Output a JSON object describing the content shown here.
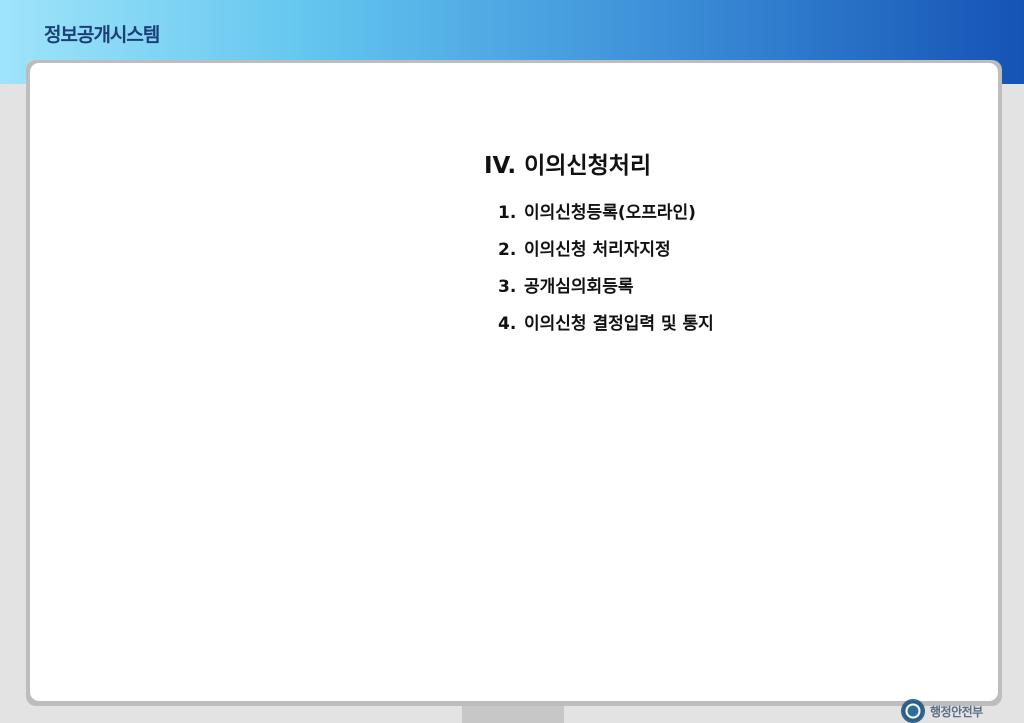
{
  "header": {
    "app_title": "정보공개시스템"
  },
  "content": {
    "section_title": "IV. 이의신청처리",
    "items": [
      {
        "number": "1.",
        "label": "이의신청등록(오프라인)"
      },
      {
        "number": "2.",
        "label": "이의신청 처리자지정"
      },
      {
        "number": "3.",
        "label": "공개심의회등록"
      },
      {
        "number": "4.",
        "label": "이의신청 결정입력 및 통지"
      }
    ]
  },
  "footer": {
    "ministry": "행정안전부",
    "emblem_icon": "government-emblem-icon"
  },
  "colors": {
    "header_gradient_start": "#9fe4fa",
    "header_gradient_end": "#1553b5",
    "title_color": "#1d3f78",
    "card_background": "#ffffff"
  }
}
